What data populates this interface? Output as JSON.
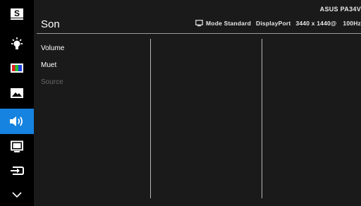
{
  "header": {
    "title": "Son",
    "model": "ASUS PA34V",
    "mode": "Mode Standard",
    "input": "DisplayPort",
    "resolution": "3440 x 1440@",
    "refresh": "100Hz"
  },
  "menu": {
    "items": [
      {
        "label": "Volume",
        "enabled": true
      },
      {
        "label": "Muet",
        "enabled": true
      },
      {
        "label": "Source",
        "enabled": false
      }
    ]
  },
  "sidebar": {
    "items": [
      {
        "icon": "splendid-icon",
        "active": false
      },
      {
        "icon": "blue-light-filter-icon",
        "active": false
      },
      {
        "icon": "color-icon",
        "active": false
      },
      {
        "icon": "image-icon",
        "active": false
      },
      {
        "icon": "sound-icon",
        "active": true
      },
      {
        "icon": "pip-pbp-icon",
        "active": false
      },
      {
        "icon": "input-select-icon",
        "active": false
      },
      {
        "icon": "chevron-down-icon",
        "active": false
      }
    ],
    "accent": "#1683e0"
  }
}
